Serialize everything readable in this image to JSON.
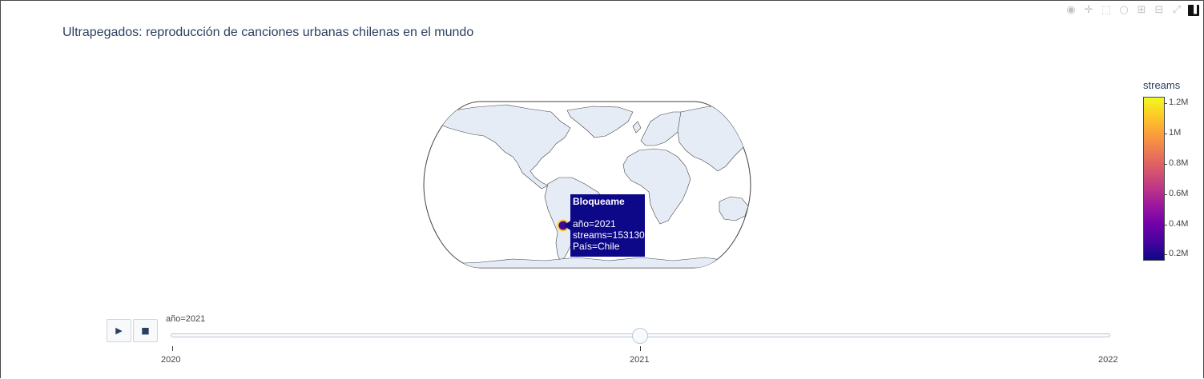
{
  "title": "Ultrapegados: reproducción de canciones urbanas chilenas en el mundo",
  "modebar": {
    "icons": [
      "camera-icon",
      "pan-icon",
      "box-select-icon",
      "lasso-icon",
      "zoom-in-icon",
      "zoom-out-icon",
      "autoscale-icon",
      "plotly-logo-icon"
    ],
    "glyphs": [
      "◉",
      "✛",
      "⬚",
      "○",
      "⊞",
      "⊟",
      "⤢",
      "▐"
    ]
  },
  "colors": {
    "land": "#e5ecf6",
    "coast": "#444444",
    "marker": "#3f0a9a",
    "marker_outline": "#fcd225",
    "tooltip_bg": "#0d0887"
  },
  "tooltip": {
    "song": "Bloqueame",
    "line1": "año=2021",
    "line2": "streams=153130",
    "line3": "País=Chile"
  },
  "colorbar": {
    "title": "streams",
    "ticks": [
      "1.2M",
      "1M",
      "0.8M",
      "0.6M",
      "0.4M",
      "0.2M"
    ],
    "colorscale": [
      "#0d0887",
      "#46039f",
      "#7201a8",
      "#9c179e",
      "#bd3786",
      "#d8576b",
      "#ed7953",
      "#fb9f3a",
      "#fdca26",
      "#f0f921"
    ]
  },
  "slider": {
    "current_label": "año=2021",
    "ticks": [
      "2020",
      "2021",
      "2022"
    ],
    "play_glyph": "▶",
    "stop_glyph": "■"
  },
  "chart_data": {
    "type": "scatter",
    "title": "Ultrapegados: reproducción de canciones urbanas chilenas en el mundo",
    "projection": "natural earth",
    "color_variable": "streams",
    "color_range": [
      153130,
      1250000
    ],
    "frame": "2021",
    "frames": [
      "2020",
      "2021",
      "2022"
    ],
    "points": [
      {
        "song": "Bloqueame",
        "year": 2021,
        "streams": 153130,
        "country": "Chile",
        "lon": -71,
        "lat": -35
      }
    ]
  }
}
